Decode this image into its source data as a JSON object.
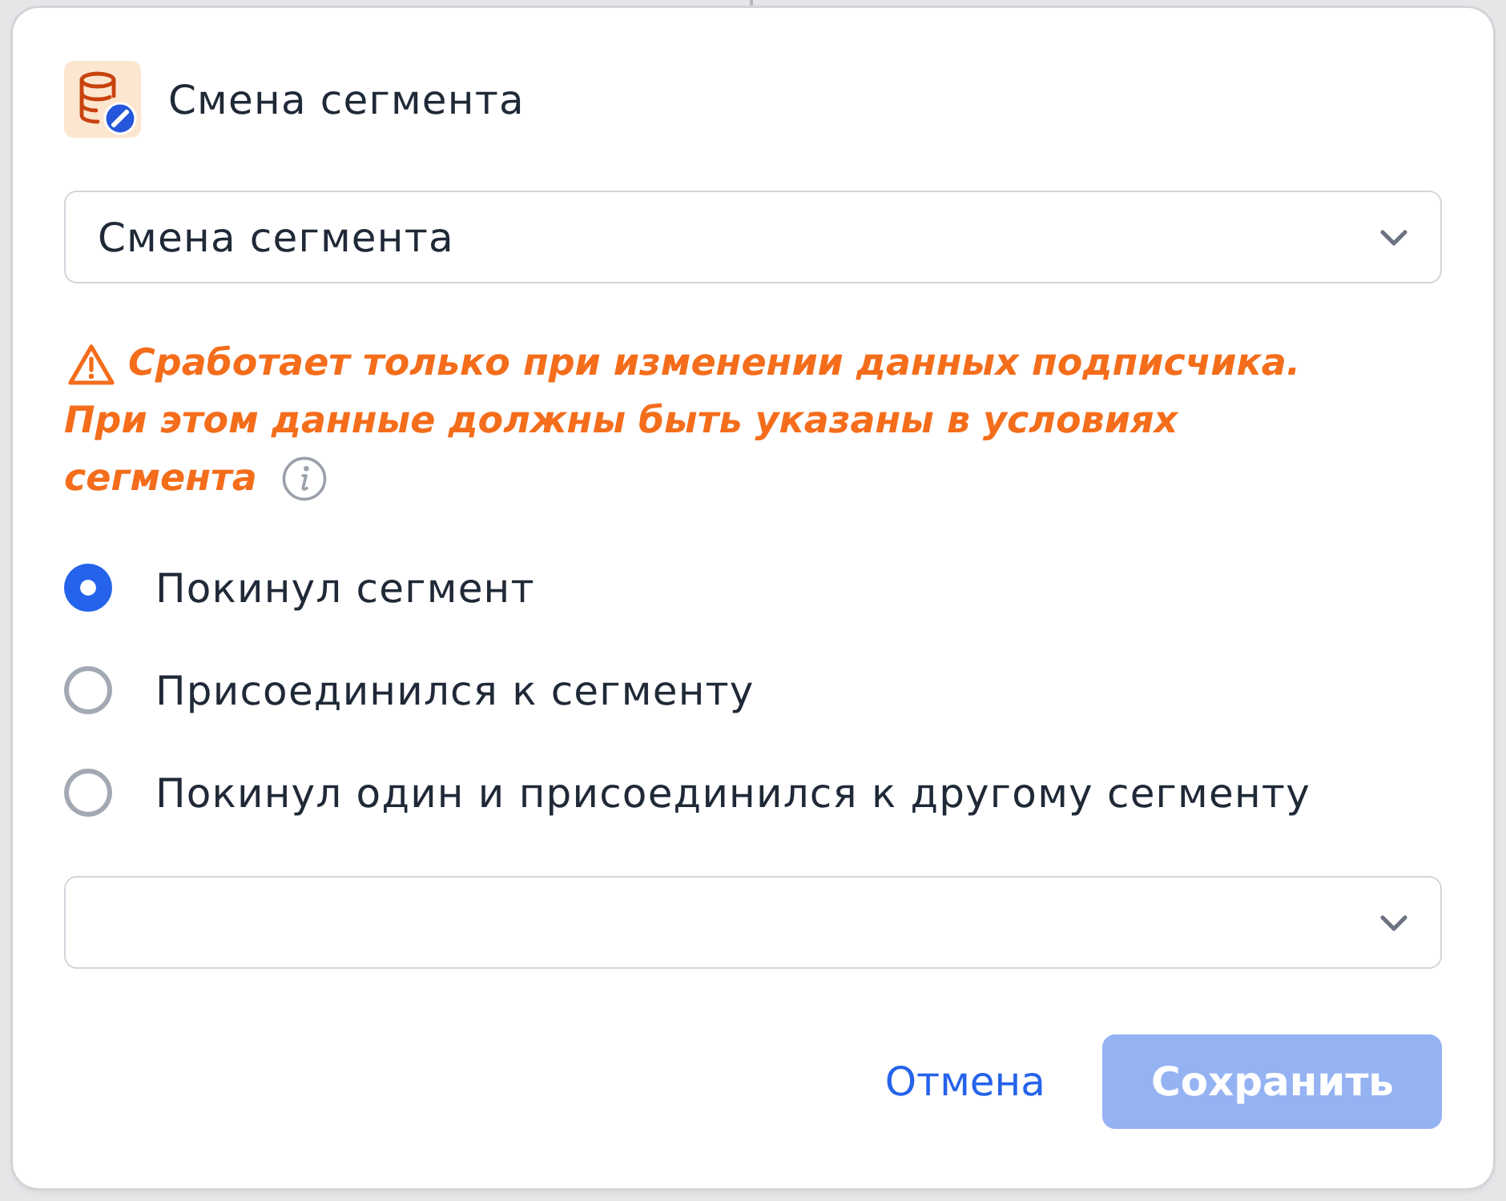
{
  "header": {
    "title": "Смена сегмента"
  },
  "event_select": {
    "value": "Смена сегмента"
  },
  "warning": {
    "lines": [
      "Сработает только при изменении данных подписчика.",
      "При этом данные должны быть указаны в условиях",
      "сегмента"
    ]
  },
  "options": [
    {
      "label": "Покинул сегмент",
      "selected": true
    },
    {
      "label": "Присоединился к сегменту",
      "selected": false
    },
    {
      "label": "Покинул один и присоединился к другому сегменту",
      "selected": false
    }
  ],
  "buttons": [
    {
      "label": "Отмена",
      "kind": "link",
      "disabled": false
    },
    {
      "label": "Сохранить",
      "kind": "primary",
      "disabled": true
    }
  ]
}
